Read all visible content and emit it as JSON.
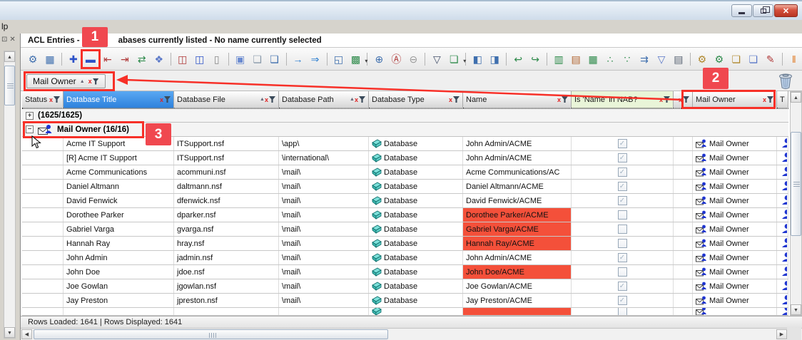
{
  "window": {
    "minimize_label": "minimize",
    "restore_label": "restore",
    "close_glyph": "✕"
  },
  "menu": {
    "partial_label": "lp"
  },
  "tab": {
    "title_left": "ACL Entries - 17",
    "title_right": "abases currently listed - No name currently selected"
  },
  "toolbar": {
    "icons": [
      {
        "name": "view-settings",
        "glyph": "⚙",
        "color": "#3f6fae"
      },
      {
        "name": "data-grid",
        "glyph": "▦",
        "color": "#3f6fae"
      },
      {
        "sep": true
      },
      {
        "name": "add-to-group",
        "glyph": "✚",
        "color": "#2d52c8"
      },
      {
        "name": "remove-from-group",
        "glyph": "▬",
        "color": "#2d52c8",
        "boxed": true
      },
      {
        "name": "promote-level",
        "glyph": "⇤",
        "color": "#b03a3a"
      },
      {
        "name": "demote-level",
        "glyph": "⇥",
        "color": "#b03a3a"
      },
      {
        "name": "refresh-groups",
        "glyph": "⇄",
        "color": "#2d8a4a"
      },
      {
        "name": "select-cluster",
        "glyph": "❖",
        "color": "#5a78c8"
      },
      {
        "sep": true
      },
      {
        "name": "insert-column",
        "glyph": "◫",
        "color": "#b03a3a"
      },
      {
        "name": "split-column",
        "glyph": "◫",
        "color": "#2d52c8"
      },
      {
        "name": "hide-column",
        "glyph": "▯",
        "color": "#8a8a8a"
      },
      {
        "sep": true
      },
      {
        "name": "selection-mode",
        "glyph": "▣",
        "color": "#6a8ad0"
      },
      {
        "name": "copy",
        "glyph": "❏",
        "color": "#8899aa"
      },
      {
        "name": "copy-table",
        "glyph": "❏",
        "color": "#3f6fae"
      },
      {
        "sep": true
      },
      {
        "name": "export-row",
        "glyph": "→",
        "color": "#2d7fd0"
      },
      {
        "name": "export-all",
        "glyph": "⇒",
        "color": "#2d7fd0"
      },
      {
        "sep": true
      },
      {
        "name": "open-in-window",
        "glyph": "◱",
        "color": "#3f6fae"
      },
      {
        "name": "multi-state-grid",
        "glyph": "▩",
        "color": "#2d8a4a",
        "dd": true
      },
      {
        "sep": true
      },
      {
        "name": "zoom-in",
        "glyph": "⊕",
        "color": "#3f6fae"
      },
      {
        "name": "zoom-font",
        "glyph": "Ⓐ",
        "color": "#b03a3a"
      },
      {
        "name": "zoom-out",
        "glyph": "⊖",
        "color": "#999999"
      },
      {
        "sep": true
      },
      {
        "name": "filter-funnel",
        "glyph": "▽",
        "color": "#44506a"
      },
      {
        "name": "new-document",
        "glyph": "❏",
        "color": "#2d8a4a",
        "dd": true
      },
      {
        "sep": true
      },
      {
        "name": "shift-column-left",
        "glyph": "◧",
        "color": "#3f6fae"
      },
      {
        "name": "shift-column-right",
        "glyph": "◨",
        "color": "#3f6fae"
      },
      {
        "sep": true
      },
      {
        "name": "return-value",
        "glyph": "↩",
        "color": "#2d8a4a"
      },
      {
        "name": "return-window",
        "glyph": "↪",
        "color": "#2d8a4a"
      },
      {
        "sep": true
      },
      {
        "name": "compare-columns",
        "glyph": "▥",
        "color": "#2d8a4a"
      },
      {
        "name": "column-ruler",
        "glyph": "▤",
        "color": "#b0632d"
      },
      {
        "name": "edit-grid",
        "glyph": "▦",
        "color": "#2d8a4a"
      },
      {
        "name": "hierarchy-view",
        "glyph": "∴",
        "color": "#2d8a4a"
      },
      {
        "name": "org-view",
        "glyph": "∵",
        "color": "#2d8a4a"
      },
      {
        "name": "process-flow",
        "glyph": "⇉",
        "color": "#3f6fae"
      },
      {
        "name": "filter-eye",
        "glyph": "▽",
        "color": "#5a78c8"
      },
      {
        "name": "keyboard-view",
        "glyph": "▤",
        "color": "#556070"
      },
      {
        "sep": true
      },
      {
        "name": "settings-folder",
        "glyph": "⚙",
        "color": "#b0882d"
      },
      {
        "name": "settings-verify",
        "glyph": "⚙",
        "color": "#2d8a4a"
      },
      {
        "name": "folder-settings",
        "glyph": "❏",
        "color": "#b0882d"
      },
      {
        "name": "copy-settings",
        "glyph": "❏",
        "color": "#5a78c8"
      },
      {
        "name": "edit-document",
        "glyph": "✎",
        "color": "#b03a3a"
      },
      {
        "sep": true
      },
      {
        "name": "column-chart",
        "glyph": "‖",
        "color": "#e07820"
      }
    ]
  },
  "groupby": {
    "chip_label": "Mail Owner"
  },
  "columns": [
    {
      "label": "Status",
      "filter": true
    },
    {
      "label": "Database Title",
      "filter": true,
      "selected": true
    },
    {
      "label": "Database File",
      "filter": true,
      "sort": "asc"
    },
    {
      "label": "Database Path",
      "filter": true,
      "sort": "asc"
    },
    {
      "label": "Database Type",
      "filter": true
    },
    {
      "label": "Name",
      "filter": true
    },
    {
      "label": "Is 'Name' in NAB?",
      "filter": true,
      "green": true
    },
    {
      "label": "",
      "filter": true
    },
    {
      "label": "Mail Owner",
      "filter": true
    },
    {
      "label": "T",
      "filter": false
    }
  ],
  "groups": [
    {
      "expander": "+",
      "label": "(1625/1625)",
      "icon": false
    },
    {
      "expander": "−",
      "label": "Mail Owner (16/16)",
      "icon": true
    }
  ],
  "rows": [
    {
      "title": "Acme IT Support",
      "file": "ITSupport.nsf",
      "path": "\\app\\",
      "type": "Database",
      "name": "John Admin/ACME",
      "alert": false,
      "checked": true,
      "owner": "Mail Owner"
    },
    {
      "title": "[R] Acme IT Support",
      "file": "ITSupport.nsf",
      "path": "\\international\\",
      "type": "Database",
      "name": "John Admin/ACME",
      "alert": false,
      "checked": true,
      "owner": "Mail Owner"
    },
    {
      "title": "Acme Communications",
      "file": "acommuni.nsf",
      "path": "\\mail\\",
      "type": "Database",
      "name": "Acme Communications/AC",
      "alert": false,
      "checked": true,
      "owner": "Mail Owner"
    },
    {
      "title": "Daniel Altmann",
      "file": "daltmann.nsf",
      "path": "\\mail\\",
      "type": "Database",
      "name": "Daniel Altmann/ACME",
      "alert": false,
      "checked": true,
      "owner": "Mail Owner"
    },
    {
      "title": "David Fenwick",
      "file": "dfenwick.nsf",
      "path": "\\mail\\",
      "type": "Database",
      "name": "David Fenwick/ACME",
      "alert": false,
      "checked": true,
      "owner": "Mail Owner"
    },
    {
      "title": "Dorothee Parker",
      "file": "dparker.nsf",
      "path": "\\mail\\",
      "type": "Database",
      "name": "Dorothee Parker/ACME",
      "alert": true,
      "checked": false,
      "owner": "Mail Owner"
    },
    {
      "title": "Gabriel Varga",
      "file": "gvarga.nsf",
      "path": "\\mail\\",
      "type": "Database",
      "name": "Gabriel Varga/ACME",
      "alert": true,
      "checked": false,
      "owner": "Mail Owner"
    },
    {
      "title": "Hannah Ray",
      "file": "hray.nsf",
      "path": "\\mail\\",
      "type": "Database",
      "name": "Hannah Ray/ACME",
      "alert": true,
      "checked": false,
      "owner": "Mail Owner"
    },
    {
      "title": "John Admin",
      "file": "jadmin.nsf",
      "path": "\\mail\\",
      "type": "Database",
      "name": "John Admin/ACME",
      "alert": false,
      "checked": true,
      "owner": "Mail Owner"
    },
    {
      "title": "John Doe",
      "file": "jdoe.nsf",
      "path": "\\mail\\",
      "type": "Database",
      "name": "John Doe/ACME",
      "alert": true,
      "checked": false,
      "owner": "Mail Owner"
    },
    {
      "title": "Joe Gowlan",
      "file": "jgowlan.nsf",
      "path": "\\mail\\",
      "type": "Database",
      "name": "Joe Gowlan/ACME",
      "alert": false,
      "checked": true,
      "owner": "Mail Owner"
    },
    {
      "title": "Jay Preston",
      "file": "jpreston.nsf",
      "path": "\\mail\\",
      "type": "Database",
      "name": "Jay Preston/ACME",
      "alert": false,
      "checked": true,
      "owner": "Mail Owner"
    }
  ],
  "partial_row": {
    "title": "",
    "file": "",
    "path": "",
    "type": "",
    "name": "",
    "alert": true,
    "checked": false,
    "owner": ""
  },
  "statusbar": {
    "text": "Rows Loaded: 1641   |   Rows Displayed: 1641"
  },
  "annotations": {
    "badge1": "1",
    "badge2": "2",
    "badge3": "3",
    "box_color": "#f73028",
    "badge_color": "#f0484f"
  }
}
